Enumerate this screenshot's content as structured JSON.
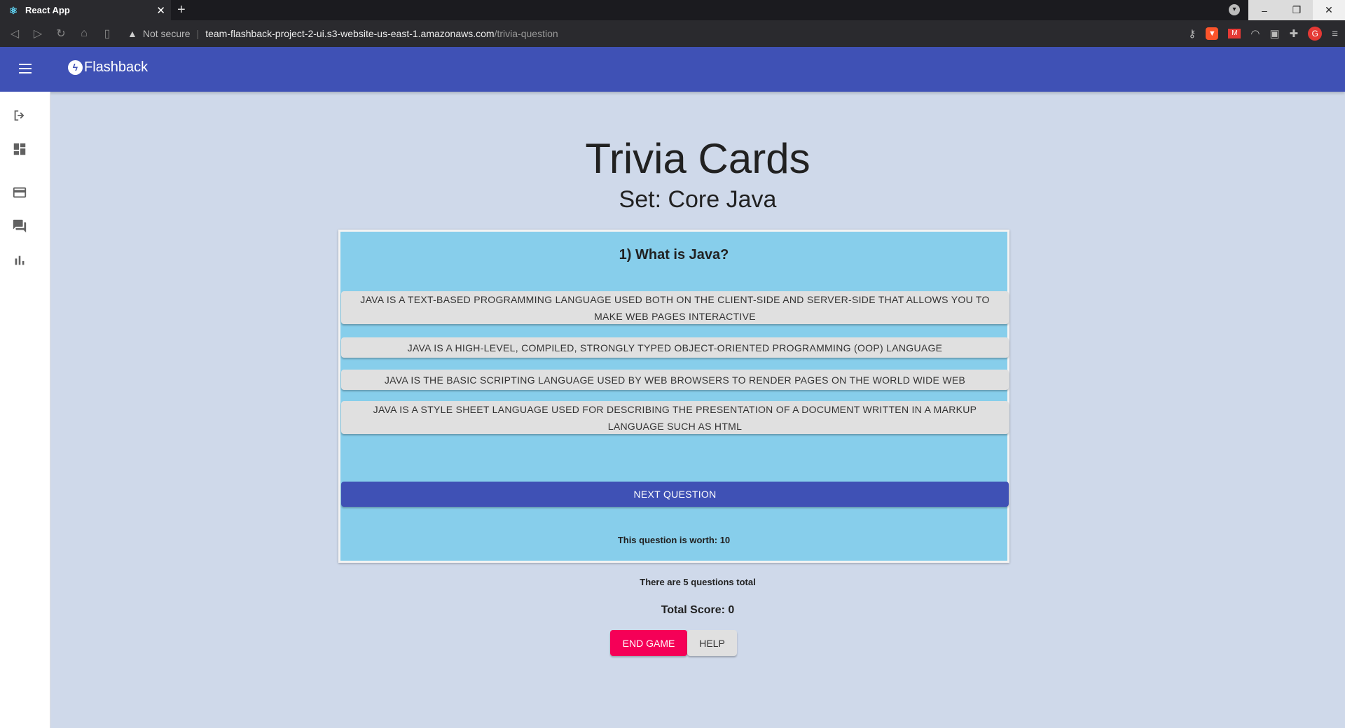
{
  "browser": {
    "tab_title": "React App",
    "security_label": "Not secure",
    "url_host": "team-flashback-project-2-ui.s3-website-us-east-1.amazonaws.com",
    "url_path": "/trivia-question"
  },
  "appbar": {
    "brand": "Flashback",
    "color": "#3f51b5"
  },
  "sidebar": {
    "items": [
      {
        "icon": "logout-icon"
      },
      {
        "icon": "dashboard-icon"
      },
      {
        "icon": "card-icon"
      },
      {
        "icon": "forum-icon"
      },
      {
        "icon": "bar-chart-icon"
      }
    ]
  },
  "main": {
    "title": "Trivia Cards",
    "subtitle": "Set: Core Java",
    "question": "1) What is Java?",
    "answers": [
      "JAVA IS A TEXT-BASED PROGRAMMING LANGUAGE USED BOTH ON THE CLIENT-SIDE AND SERVER-SIDE THAT ALLOWS YOU TO MAKE WEB PAGES INTERACTIVE",
      "JAVA IS A HIGH-LEVEL, COMPILED, STRONGLY TYPED OBJECT-ORIENTED PROGRAMMING (OOP) LANGUAGE",
      "JAVA IS THE BASIC SCRIPTING LANGUAGE USED BY WEB BROWSERS TO RENDER PAGES ON THE WORLD WIDE WEB",
      "JAVA IS A STYLE SHEET LANGUAGE USED FOR DESCRIBING THE PRESENTATION OF A DOCUMENT WRITTEN IN A MARKUP LANGUAGE SUCH AS HTML"
    ],
    "next_label": "NEXT QUESTION",
    "worth": "This question is worth: 10",
    "total_questions": "There are 5 questions total",
    "score": "Total Score: 0",
    "end_label": "END GAME",
    "help_label": "HELP"
  },
  "colors": {
    "card": "#87ceeb",
    "background": "#cfd9ea",
    "end_button": "#f50057"
  }
}
